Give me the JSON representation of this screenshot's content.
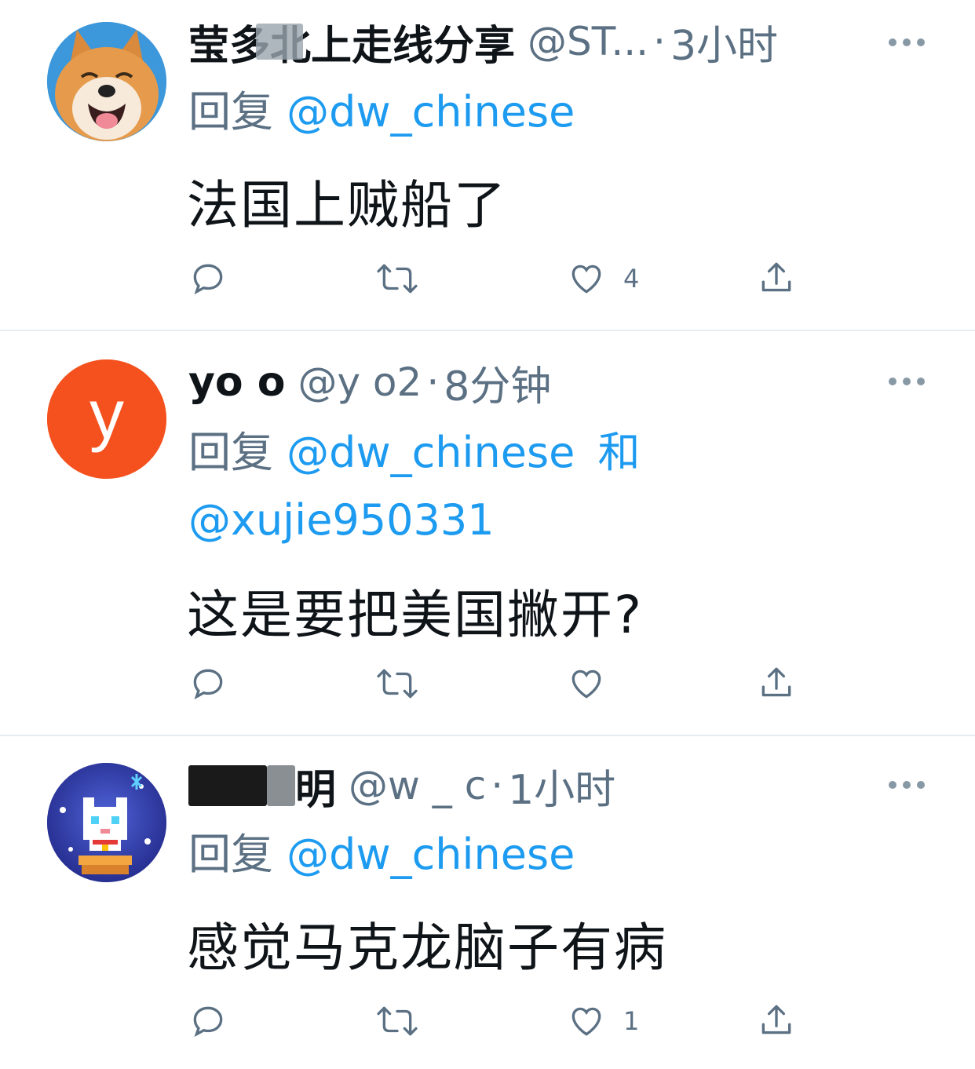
{
  "tweets": [
    {
      "name": "莹多北上走线分享",
      "handle": "@ST...",
      "separator": "·",
      "time": "3小时",
      "reply_prefix": "回复",
      "reply_to": [
        "@dw_chinese"
      ],
      "reply_joiner": "",
      "text": "法国上贼船了",
      "likes": "4",
      "avatar": "shiba-dog"
    },
    {
      "name": "yo  o",
      "handle": "@y    o2",
      "separator": "·",
      "time": "8分钟",
      "reply_prefix": "回复",
      "reply_to": [
        "@dw_chinese",
        "@xujie950331"
      ],
      "reply_joiner": "和",
      "text": "这是要把美国撇开?",
      "likes": "",
      "avatar": "letter-y",
      "avatar_letter": "y"
    },
    {
      "name": "  明",
      "handle": "@w   _  c",
      "separator": "·",
      "time": "1小时",
      "reply_prefix": "回复",
      "reply_to": [
        "@dw_chinese"
      ],
      "reply_joiner": "",
      "text": "感觉马克龙脑子有病",
      "likes": "1",
      "avatar": "pixel-cat"
    }
  ],
  "colors": {
    "mention": "#1d9bf0",
    "secondary": "#5b7083",
    "divider": "#e6ecf0",
    "avatar_y": "#f4511e"
  },
  "icons": [
    "reply-icon",
    "retweet-icon",
    "like-icon",
    "share-icon",
    "more-icon"
  ]
}
